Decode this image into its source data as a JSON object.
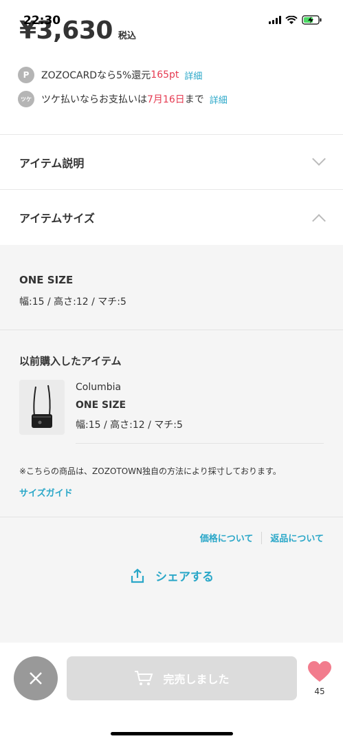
{
  "status": {
    "time": "22:30"
  },
  "price": {
    "amount": "¥3,630",
    "tax_label": "税込"
  },
  "promos": [
    {
      "icon": "P",
      "text_before": "ZOZOCARDなら5%還元 ",
      "highlight": "165pt",
      "text_after": "",
      "link": "詳細"
    },
    {
      "icon": "ツケ",
      "text_before": "ツケ払いならお支払いは",
      "highlight": "7月16日",
      "text_after": "まで",
      "link": "詳細"
    }
  ],
  "accordions": {
    "description": "アイテム説明",
    "size": "アイテムサイズ"
  },
  "size_info": {
    "name": "ONE SIZE",
    "dims": "幅:15 / 高さ:12 / マチ:5"
  },
  "previous": {
    "title": "以前購入したアイテム",
    "brand": "Columbia",
    "size": "ONE SIZE",
    "dims": "幅:15 / 高さ:12 / マチ:5"
  },
  "note": "※こちらの商品は、ZOZOTOWN独自の方法により採寸しております。",
  "size_guide": "サイズガイド",
  "links": {
    "price": "価格について",
    "returns": "返品について"
  },
  "share": "シェアする",
  "bottom": {
    "sold_out": "完売しました",
    "fav_count": "45"
  },
  "colors": {
    "accent": "#2aa7c8",
    "highlight": "#e53950",
    "heart": "#f27c8d"
  }
}
